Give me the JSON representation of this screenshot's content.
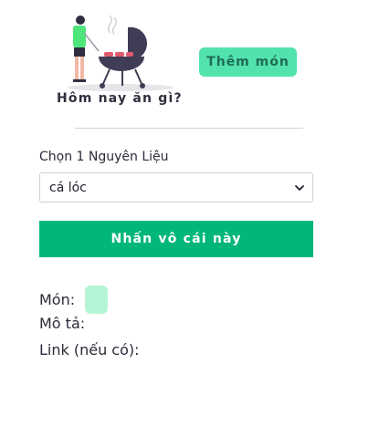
{
  "header": {
    "title": "Hôm nay ăn gì?",
    "add_button_label": "Thêm món",
    "illustration": "person-grilling-bbq-illustration"
  },
  "form": {
    "ingredient_label": "Chọn 1 Nguyên Liệu",
    "ingredient_selected": "cá lóc",
    "submit_label": "Nhấn vô cái này"
  },
  "result": {
    "dish_label": "Món:",
    "description_label": "Mô tả:",
    "link_label": "Link (nếu có):"
  },
  "colors": {
    "accent": "#00b67a",
    "accent_light": "#52e3ad",
    "chip": "#b5f5d6"
  }
}
